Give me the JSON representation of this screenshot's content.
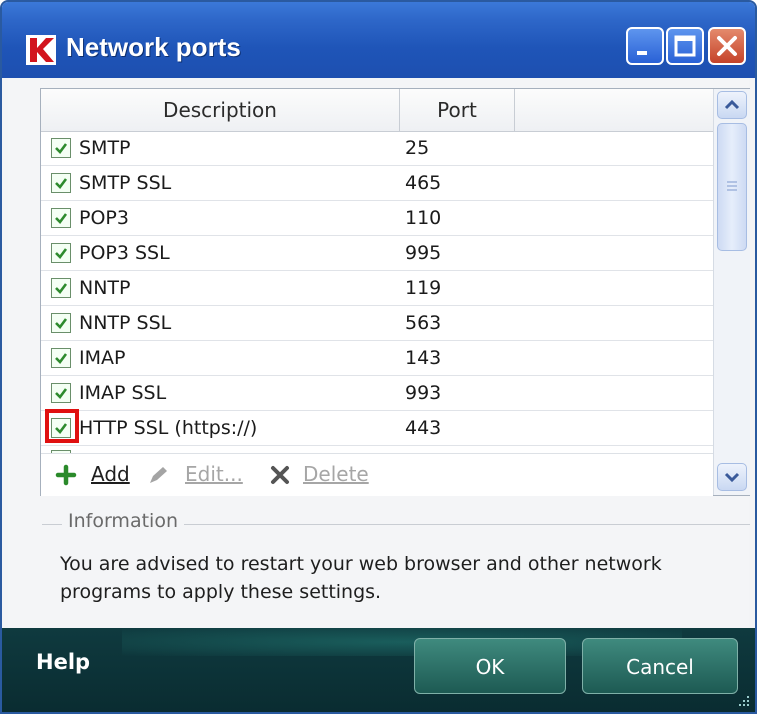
{
  "window": {
    "title": "Network ports"
  },
  "list": {
    "columns": [
      "Description",
      "Port"
    ],
    "rows": [
      {
        "checked": true,
        "description": "SMTP",
        "port": "25"
      },
      {
        "checked": true,
        "description": "SMTP SSL",
        "port": "465"
      },
      {
        "checked": true,
        "description": "POP3",
        "port": "110"
      },
      {
        "checked": true,
        "description": "POP3 SSL",
        "port": "995"
      },
      {
        "checked": true,
        "description": "NNTP",
        "port": "119"
      },
      {
        "checked": true,
        "description": "NNTP SSL",
        "port": "563"
      },
      {
        "checked": true,
        "description": "IMAP",
        "port": "143"
      },
      {
        "checked": true,
        "description": "IMAP SSL",
        "port": "993"
      },
      {
        "checked": true,
        "description": "HTTP SSL (https://)",
        "port": "443",
        "highlighted": true
      }
    ],
    "toolbar": {
      "add": "Add",
      "edit": "Edit...",
      "delete": "Delete"
    }
  },
  "info": {
    "label": "Information",
    "text": "You are advised to restart your web browser and other network programs to apply these settings."
  },
  "footer": {
    "help": "Help",
    "ok": "OK",
    "cancel": "Cancel"
  },
  "colors": {
    "titlebar": "#2d66c8",
    "footer": "#0d3338",
    "highlight": "#e01010",
    "check": "#2e8b2e",
    "add_icon": "#2a8a2a"
  }
}
